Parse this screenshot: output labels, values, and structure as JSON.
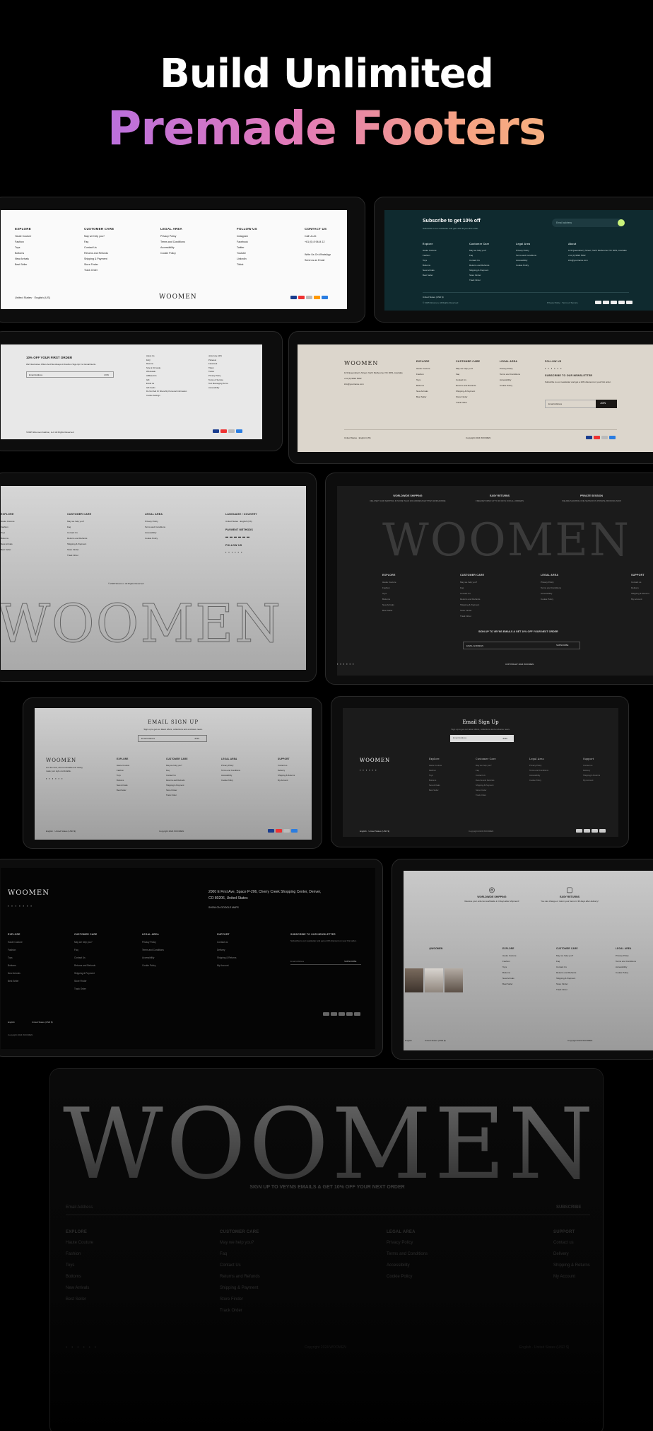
{
  "hero": {
    "line1": "Build Unlimited",
    "line2": "Premade Footers"
  },
  "brand": "WOOMEN",
  "cols": {
    "explore": "EXPLORE",
    "customer": "CUSTOMER CARE",
    "legal": "LEGAL AREA",
    "follow": "FOLLOW US",
    "contact": "CONTACT US",
    "support": "SUPPORT"
  },
  "explore_items": [
    "Haute Couture",
    "Fashion",
    "Toys",
    "Bottoms",
    "New Arrivals",
    "Best Seller"
  ],
  "customer_items": [
    "May we help you?",
    "Faq",
    "Contact Us",
    "Returns and Refunds",
    "Shipping & Payment",
    "Store Finder",
    "Track Order"
  ],
  "legal_items": [
    "Privacy Policy",
    "Terms and Conditions",
    "Accessibility",
    "Cookie Policy"
  ],
  "support_items": [
    "Contact us",
    "Delivery",
    "Shipping & Returns",
    "My Account"
  ],
  "follow_items": [
    "Instagram",
    "Facebook",
    "Twitter",
    "Youtube",
    "LinkedIn",
    "Tiktok"
  ],
  "contact_items": [
    "Call Us At:",
    "+61 (0) 8 9444 12",
    "Write Us On WhatsApp",
    "Send us an Email"
  ],
  "f1": {
    "locale": "United States · English (US)"
  },
  "f2": {
    "title": "Subscribe to get 10% off",
    "sub": "Subscribe to our newsletter and get 10% off your first order.",
    "email": "Email address",
    "copy": "© 2025 Woomen, All Rights Reserved",
    "links": "Privacy Policy · Terms of Service",
    "locale": "United States (USD $)",
    "c1": "Explore",
    "c2": "Customer Care",
    "c3": "Legal Area",
    "c4": "About"
  },
  "f3": {
    "title": "10% OFF YOUR FIRST ORDER",
    "sub": "We'll Exclusive Offers And Be Always At Fashion Sign-Up For Email Alerts.",
    "email": "Email Address",
    "join": "JOIN",
    "copy": "©2025 Woomen Fashion, LLC All Rights Reserved",
    "a": [
      "About Us",
      "FAQ",
      "Returns",
      "Size & Fit Guide",
      "Wholesale",
      "Affiliate Info",
      "Gift",
      "Email Us",
      "Gift Cards",
      "Do Not Sell Or Share My Personal Information",
      "Cookie Settings"
    ],
    "b": [
      "Jobs Give 10%",
      "Pinterest",
      "Facebook",
      "Tiktok",
      "Twitter",
      "Privacy Policy",
      "Terms of Service",
      "Text Messaging Terms",
      "Accessibility"
    ]
  },
  "f4": {
    "address": "123 Queensberry Street, North Melbourne VIC 3051, Australia",
    "phone": "+61 (0) 9824 5002",
    "email": "info@yourname.com",
    "news": "SUBSCRIBE TO OUR NEWSLETTER",
    "news_sub": "Subscribe to our newsletter and get a 10% discount on your first order.",
    "email_ph": "Email Address",
    "join": "JOIN",
    "copy": "Copyright 2024 WOOMEN",
    "locale": "United States · English (US)"
  },
  "f5": {
    "lang": "LANGUAGE / COUNTRY",
    "locale": "United States · English (US)",
    "pay": "PAYMENT METHODS",
    "follow": "FOLLOW US",
    "copy": "© 2025 Woomen. All Rights Reserved."
  },
  "f6": {
    "s1": "WORLDWIDE SHIPPING",
    "s1t": "DELIVERY AND SHIPPING IN MORE THAN 200 ADDRESS ENTITIES WORLDWIDE",
    "s2": "EASY RETURNS",
    "s2t": "FREE RETURNS UP TO 30 DAYS FOR ALL ORDERS",
    "s3": "PRIVATE SESSION",
    "s3t": "WE ARE SHOWING ONE SESSION IN PRIVATE, BOOKING NOW",
    "signup": "SIGN UP TO VEYNS EMAILS & GET 10% OFF YOUR NEXT ORDER",
    "email": "EMAIL ADDRESS",
    "sub": "SUBSCRIBE",
    "copy": "COPYRIGHT 2024 WOOMEN"
  },
  "f7": {
    "title": "EMAIL SIGN UP",
    "sub": "Sign up to get our latest offers, collections and exclusive news.",
    "email": "Email Address",
    "join": "JOIN",
    "copy": "Copyright 2024 WOOMEN",
    "locale": "English · United States (USD $)",
    "tag": "Live the best, with comfortable and classy, make your style comfortable."
  },
  "f8": {
    "title": "Email Sign Up",
    "sub": "Sign up to get our latest offers, collections and exclusive news.",
    "email": "Email Address",
    "join": "JOIN",
    "copy": "Copyright 2024 WOOMEN",
    "c1": "Explore",
    "c2": "Customer Care",
    "c3": "Legal Area",
    "c4": "Support"
  },
  "f9": {
    "address": "2000 E First Ave, Space P-206, Cherry Creek Shopping Center, Denver, CO 80206, United States",
    "show": "SHOW ON GOOGLE MAPS",
    "news": "SUBSCRIBE TO OUR NEWSLETTER",
    "news_sub": "Subscribe to our newsletter and get a 10% discount on your first order.",
    "email": "Email Address",
    "sub": "SUBSCRIBE",
    "lang": "English",
    "locale": "United States (USD $)",
    "copy": "Copyright 2024 WOOMEN"
  },
  "f10": {
    "s1": "WORLDWIDE SHIPPING",
    "s1t": "Receive your order as worldwide in 3 days after shipment!",
    "s2": "EASY RETURNS",
    "s2t": "You can change or return your items in 30 days after delivery!",
    "handle": "@WOOMEN",
    "lang": "English",
    "locale": "United States (USD $)",
    "copy": "Copyright 2024 WOOMEN"
  },
  "f11": {
    "signup": "SIGN UP TO VEYNS EMAILS & GET 10% OFF YOUR NEXT ORDER",
    "email": "Email Address",
    "sub": "SUBSCRIBE",
    "copy": "Copyright 2024 WOOMEN",
    "locale": "English · United States (USD $)"
  }
}
